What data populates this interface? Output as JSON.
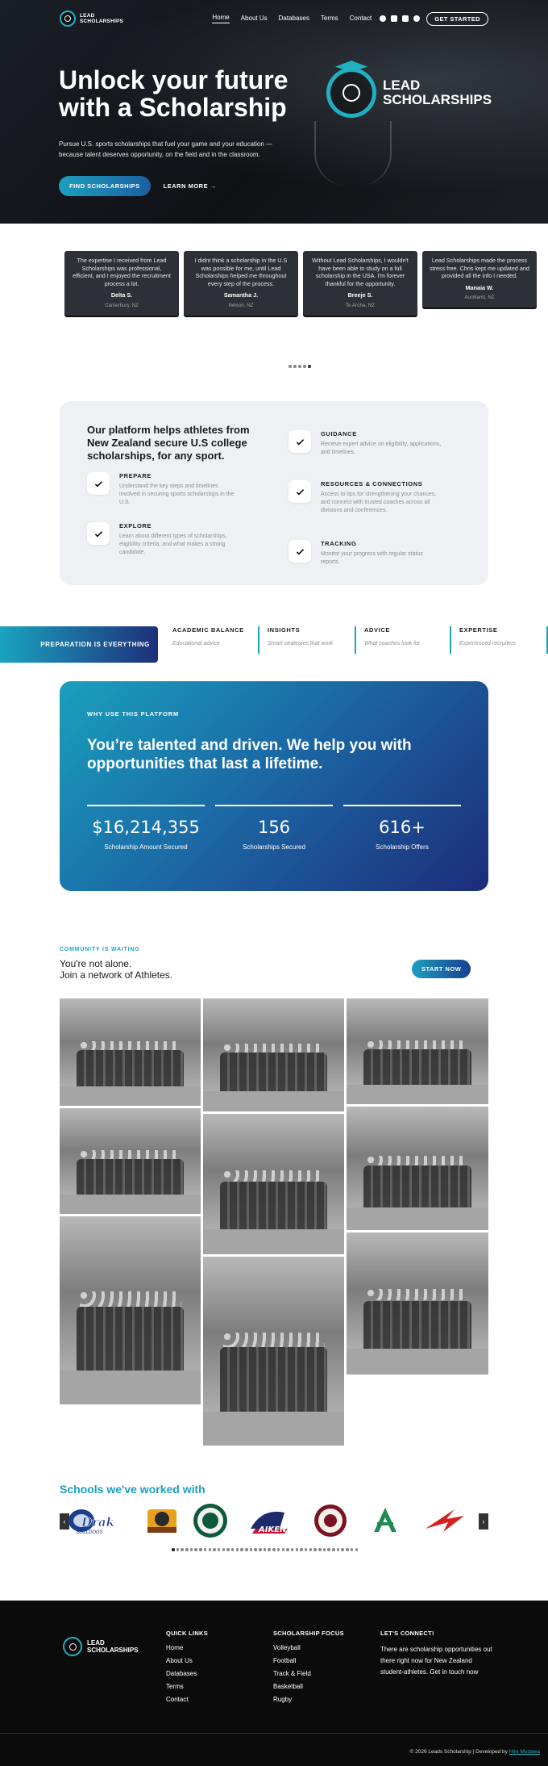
{
  "nav": {
    "logo_line1": "LEAD",
    "logo_line2": "SCHOLARSHIPS",
    "links": [
      "Home",
      "About Us",
      "Databases",
      "Terms",
      "Contact"
    ],
    "cta": "GET STARTED"
  },
  "hero": {
    "title": "Unlock your future with a Scholarship",
    "subtitle": "Pursue U.S. sports scholarships that fuel your game and your education — because talent deserves opportunity, on the field and in the classroom.",
    "primary_btn": "FIND SCHOLARSHIPS",
    "secondary_btn": "LEARN MORE",
    "logo_line1": "LEAD",
    "logo_line2": "SCHOLARSHIPS"
  },
  "testimonials": [
    {
      "quote": "The expertise I received from Lead Scholarships was professional, efficient, and I enjoyed the recruitment process a lot.",
      "name": "Delta S.",
      "location": "Canterbury, NZ"
    },
    {
      "quote": "I didnt think a scholarship in the U.S was possible for me, until Lead Scholarships helped me throughout every step of the process.",
      "name": "Samantha J.",
      "location": "Nelson, NZ"
    },
    {
      "quote": "Without Lead Scholarships, I wouldn't have been able to study on a full scholarship in the USA. I'm forever thankful for the opportunity.",
      "name": "Breeje S.",
      "location": "Te Aroha, NZ"
    },
    {
      "quote": "Lead Scholarships made the process stress free. Chris kept me updated and provided all the info I needed.",
      "name": "Manaia W.",
      "location": "Auckland, NZ"
    }
  ],
  "platform": {
    "title": "Our platform helps athletes from New Zealand secure U.S college scholarships, for any sport.",
    "features": [
      {
        "heading": "PREPARE",
        "text": "Understand the key steps and timelines involved in securing sports scholarships in the U.S."
      },
      {
        "heading": "EXPLORE",
        "text": "Learn about different types of scholarships, eligibility criteria, and what makes a strong candidate."
      },
      {
        "heading": "GUIDANCE",
        "text": "Receive expert advice on eligibility, applications, and timelines."
      },
      {
        "heading": "RESOURCES & CONNECTIONS",
        "text": "Access to tips for strengthening your chances, and connect with trusted coaches across all divisions and conferences."
      },
      {
        "heading": "TRACKING",
        "text": "Monitor your progress with regular status reports."
      }
    ]
  },
  "ticker": {
    "lead": "PREPARATION IS EVERYTHING",
    "items": [
      {
        "heading": "ACADEMIC BALANCE",
        "sub": "Educational advice"
      },
      {
        "heading": "INSIGHTS",
        "sub": "Smart strategies that work"
      },
      {
        "heading": "ADVICE",
        "sub": "What coaches look for"
      },
      {
        "heading": "EXPERTISE",
        "sub": "Experienced recruiters"
      }
    ]
  },
  "stats": {
    "eyebrow": "WHY USE THIS PLATFORM",
    "title": "You’re talented and driven. We help you with opportunities that last a lifetime.",
    "items": [
      {
        "value": "$16,214,355",
        "label": "Scholarship Amount Secured"
      },
      {
        "value": "156",
        "label": "Scholarships Secured"
      },
      {
        "value": "616+",
        "label": "Scholarship Offers"
      }
    ]
  },
  "community": {
    "eyebrow": "COMMUNITY IS WAITING",
    "title_line1": "You're not alone.",
    "title_line2": "Join a network of Athletes.",
    "cta": "START NOW"
  },
  "schools": {
    "title": "Schools we've worked with",
    "logos": [
      "Drake Bulldogs",
      "Tigers",
      "Green",
      "Aiken",
      "Seal",
      "NM",
      "Red Hawk"
    ]
  },
  "footer": {
    "logo_line1": "LEAD",
    "logo_line2": "SCHOLARSHIPS",
    "quick_links_heading": "QUICK LINKS",
    "quick_links": [
      "Home",
      "About Us",
      "Databases",
      "Terms",
      "Contact"
    ],
    "focus_heading": "SCHOLARSHIP FOCUS",
    "focus": [
      "Volleyball",
      "Football",
      "Track & Field",
      "Basketball",
      "Rugby"
    ],
    "connect_heading": "LET'S CONNECT!",
    "connect_text": "There are scholarship opportunities out there right now for New Zealand student-athletes. Get in touch now",
    "copyright": "© 2026 Leads Scholarship | Developed by ",
    "dev_link": "Hire Mudawa"
  },
  "colors": {
    "accent": "#1fb1c0",
    "navy": "#1d2c7a",
    "dark": "#0b0b0b"
  }
}
